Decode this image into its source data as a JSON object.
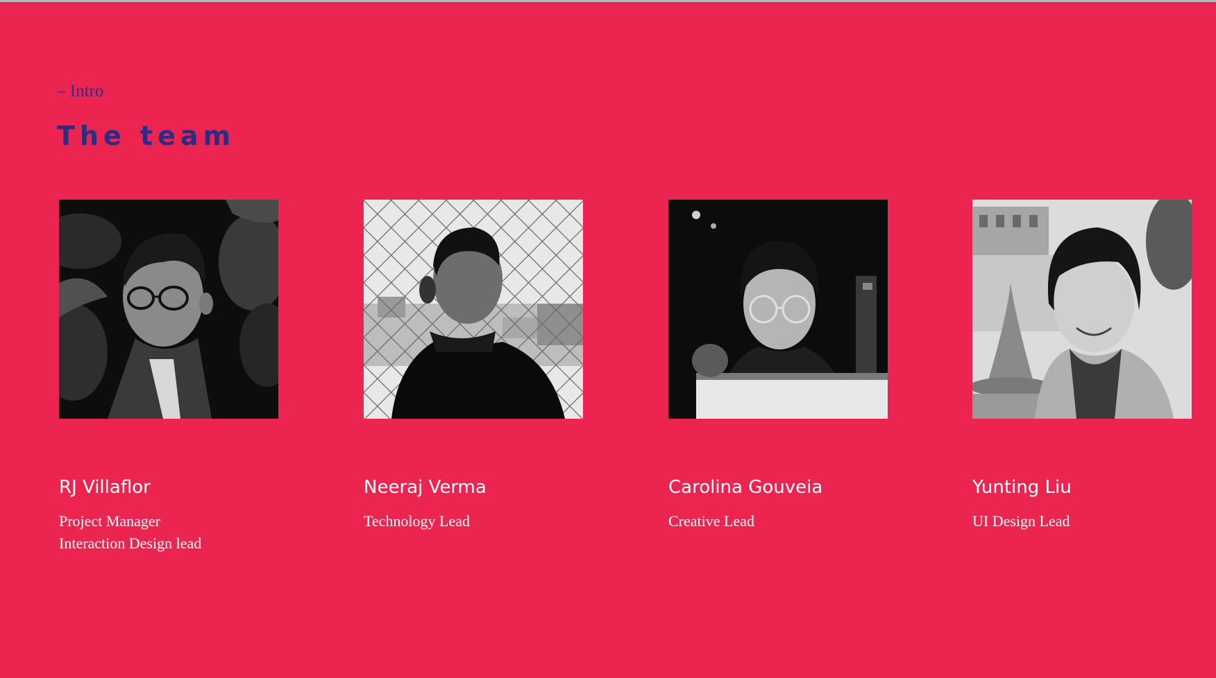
{
  "intro": {
    "eyebrow": "– Intro",
    "title": "The team"
  },
  "colors": {
    "background": "#ec2450",
    "title": "#2b2d84",
    "eyebrow": "#3a2a86",
    "text": "#ffffff"
  },
  "team": [
    {
      "name": "RJ Villaflor",
      "roles": [
        "Project Manager",
        "Interaction Design lead"
      ],
      "photo": "portrait-photo"
    },
    {
      "name": "Neeraj Verma",
      "roles": [
        "Technology Lead"
      ],
      "photo": "portrait-photo"
    },
    {
      "name": "Carolina Gouveia",
      "roles": [
        "Creative Lead"
      ],
      "photo": "portrait-photo"
    },
    {
      "name": "Yunting Liu",
      "roles": [
        "UI Design Lead"
      ],
      "photo": "portrait-photo"
    }
  ]
}
